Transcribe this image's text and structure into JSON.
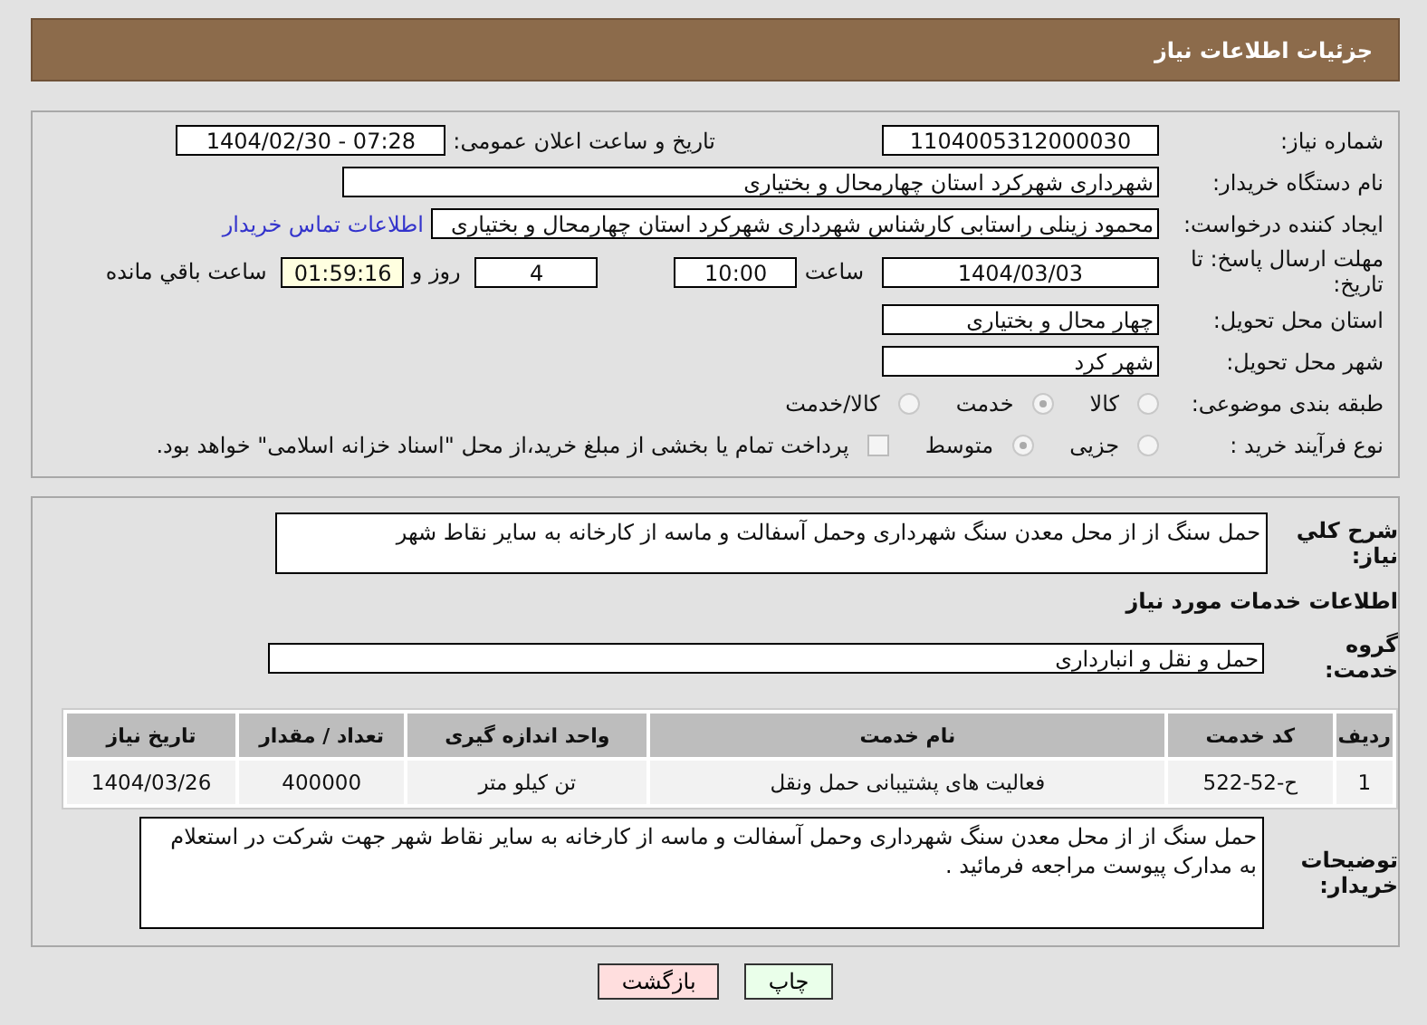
{
  "header": {
    "title": "جزئیات اطلاعات نیاز"
  },
  "need_number": {
    "label": "شماره نیاز:",
    "value": "1104005312000030"
  },
  "announce": {
    "label": "تاریخ و ساعت اعلان عمومی:",
    "value": "1404/02/30 - 07:28"
  },
  "buyer_org": {
    "label": "نام دستگاه خریدار:",
    "value": "شهرداری شهرکرد استان چهارمحال و بختیاری"
  },
  "requester": {
    "label": "ایجاد کننده درخواست:",
    "value": "محمود زینلی راستابی کارشناس شهرداری شهرکرد استان چهارمحال و بختیاری",
    "link": "اطلاعات تماس خریدار"
  },
  "deadline": {
    "label": "مهلت ارسال پاسخ: تا تاریخ:",
    "date": "1404/03/03",
    "time_label": "ساعت",
    "time": "10:00",
    "days": "4",
    "days_label": "روز و",
    "remaining": "01:59:16",
    "remaining_label": "ساعت باقي مانده"
  },
  "province": {
    "label": "استان محل تحویل:",
    "value": "چهار محال و بختیاری"
  },
  "city": {
    "label": "شهر محل تحویل:",
    "value": "شهر کرد"
  },
  "category": {
    "label": "طبقه بندی موضوعی:",
    "options": [
      {
        "label": "کالا",
        "selected": false
      },
      {
        "label": "خدمت",
        "selected": true
      },
      {
        "label": "کالا/خدمت",
        "selected": false
      }
    ]
  },
  "process": {
    "label": "نوع فرآیند خرید :",
    "options": [
      {
        "label": "جزیی",
        "selected": false
      },
      {
        "label": "متوسط",
        "selected": true
      }
    ],
    "payment": {
      "checked": false,
      "text": "پرداخت تمام یا بخشی از مبلغ خرید،از محل \"اسناد خزانه اسلامی\" خواهد بود."
    }
  },
  "description": {
    "label": "شرح کلي نياز:",
    "value": "حمل سنگ از از محل معدن سنگ شهرداری وحمل آسفالت و ماسه از کارخانه به سایر نقاط شهر"
  },
  "services": {
    "title": "اطلاعات خدمات مورد نیاز",
    "group_label": "گروه خدمت:",
    "group_value": "حمل و نقل و انبارداری",
    "table": {
      "columns": [
        "ردیف",
        "کد خدمت",
        "نام خدمت",
        "واحد اندازه گیری",
        "تعداد / مقدار",
        "تاریخ نیاز"
      ],
      "rows": [
        [
          "1",
          "ح-52-522",
          "فعالیت های پشتیبانی حمل ونقل",
          "تن کیلو متر",
          "400000",
          "1404/03/26"
        ]
      ]
    }
  },
  "buyer_notes": {
    "label": "توضیحات خریدار:",
    "value": "حمل سنگ از از محل معدن سنگ شهرداری وحمل آسفالت و ماسه از کارخانه به سایر نقاط شهر جهت شرکت در استعلام به مدارک پیوست مراجعه فرمائید ."
  },
  "buttons": [
    {
      "kind": "print",
      "label": "چاپ"
    },
    {
      "kind": "back",
      "label": "بازگشت"
    }
  ]
}
